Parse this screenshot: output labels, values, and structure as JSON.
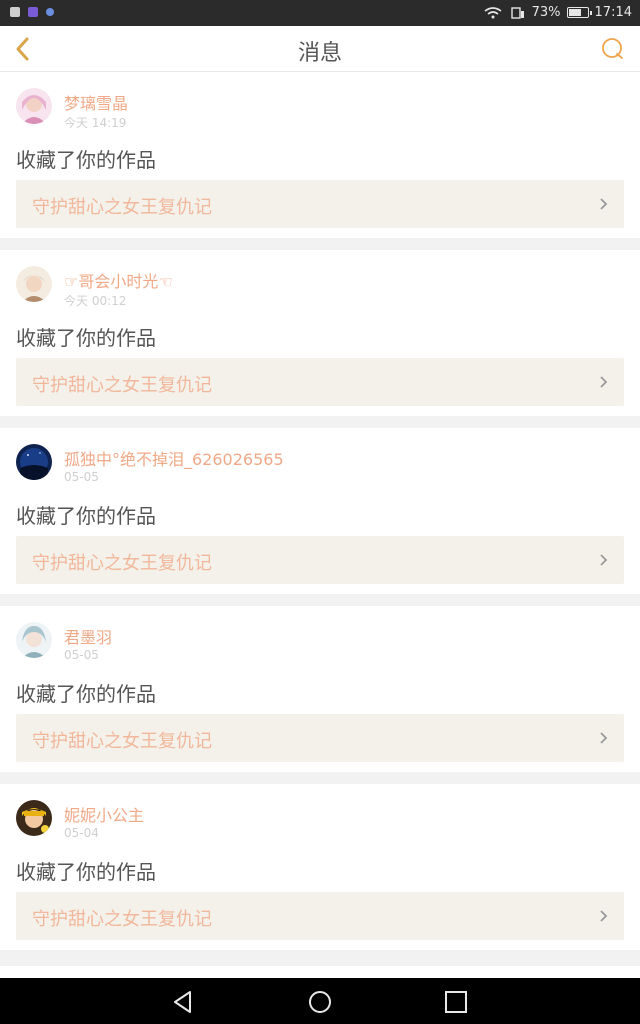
{
  "status_bar": {
    "battery_percent": "73%",
    "time": "17:14",
    "battery_level": 0.73,
    "icons": [
      "notification-icon",
      "app-icon",
      "dot-icon",
      "wifi-icon",
      "sim-icon",
      "battery-icon"
    ]
  },
  "header": {
    "title": "消息",
    "back_icon": "chevron-left-icon",
    "right_icon": "chat-bubble-icon",
    "accent": "#d8a54a"
  },
  "messages": [
    {
      "username": "梦璃雪晶",
      "time": "今天 14:19",
      "action": "收藏了你的作品",
      "work_title": "守护甜心之女王复仇记"
    },
    {
      "username": "☞哥会小时光☜",
      "time": "今天 00:12",
      "action": "收藏了你的作品",
      "work_title": "守护甜心之女王复仇记"
    },
    {
      "username": "孤独中°绝不掉泪_626026565",
      "time": "05-05",
      "action": "收藏了你的作品",
      "work_title": "守护甜心之女王复仇记"
    },
    {
      "username": "君墨羽",
      "time": "05-05",
      "action": "收藏了你的作品",
      "work_title": "守护甜心之女王复仇记"
    },
    {
      "username": "妮妮小公主",
      "time": "05-04",
      "action": "收藏了你的作品",
      "work_title": "守护甜心之女王复仇记"
    }
  ],
  "colors": {
    "username": "#f0a987",
    "work_title": "#f2b79b",
    "work_bg": "#f3f1ea",
    "background": "#f2f2f2"
  },
  "nav_bar": [
    "back-triangle-icon",
    "home-circle-icon",
    "recents-square-icon"
  ]
}
